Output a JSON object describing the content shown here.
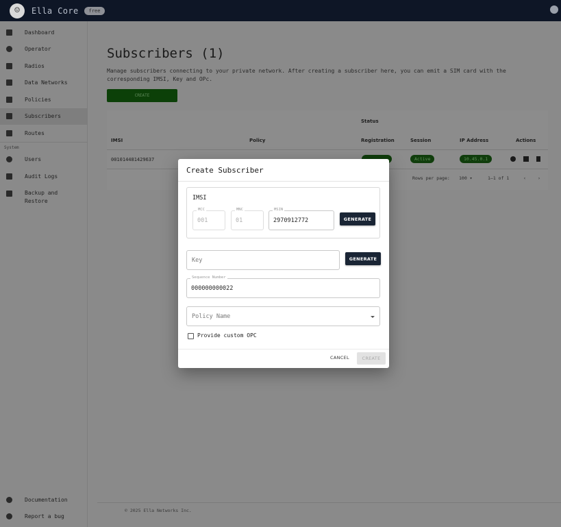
{
  "app": {
    "title": "Ella Core",
    "plan_badge": "free"
  },
  "sidebar": {
    "items": [
      {
        "label": "Dashboard",
        "icon": "dashboard-icon"
      },
      {
        "label": "Operator",
        "icon": "antenna-icon"
      },
      {
        "label": "Radios",
        "icon": "router-icon"
      },
      {
        "label": "Data Networks",
        "icon": "network-icon"
      },
      {
        "label": "Policies",
        "icon": "tune-icon"
      },
      {
        "label": "Subscribers",
        "icon": "people-icon",
        "active": true
      },
      {
        "label": "Routes",
        "icon": "routes-icon"
      }
    ],
    "system_label": "System",
    "system_items": [
      {
        "label": "Users",
        "icon": "user-gear-icon"
      },
      {
        "label": "Audit Logs",
        "icon": "log-icon"
      },
      {
        "label": "Backup and Restore",
        "icon": "backup-icon"
      }
    ],
    "bottom_items": [
      {
        "label": "Documentation",
        "icon": "info-icon"
      },
      {
        "label": "Report a bug",
        "icon": "bug-icon"
      }
    ]
  },
  "page": {
    "title": "Subscribers (1)",
    "description": "Manage subscribers connecting to your private network. After creating a subscriber here, you can emit a SIM card with the corresponding IMSI, Key and OPc.",
    "create_label": "CREATE"
  },
  "table": {
    "group_header": "Status",
    "columns": [
      "IMSI",
      "Policy",
      "Registration",
      "Session",
      "IP Address",
      "Actions"
    ],
    "rows": [
      {
        "imsi": "001014481429637",
        "session": "Active",
        "ip": "10.45.0.1"
      }
    ],
    "rows_per_page_label": "Rows per page:",
    "rows_per_page_value": "100",
    "range": "1–1 of 1"
  },
  "footer": {
    "copyright": "© 2025 Ella Networks Inc."
  },
  "modal": {
    "title": "Create Subscriber",
    "imsi_label": "IMSI",
    "mcc": {
      "label": "MCC",
      "value": "001"
    },
    "mnc": {
      "label": "MNC",
      "value": "01"
    },
    "msin": {
      "label": "MSIN",
      "value": "2970912772"
    },
    "generate_label": "GENERATE",
    "key_placeholder": "Key",
    "sequence": {
      "label": "Sequence Number",
      "value": "000000000022"
    },
    "policy_placeholder": "Policy Name",
    "custom_opc_label": "Provide custom OPC",
    "cancel_label": "CANCEL",
    "create_label": "CREATE"
  }
}
